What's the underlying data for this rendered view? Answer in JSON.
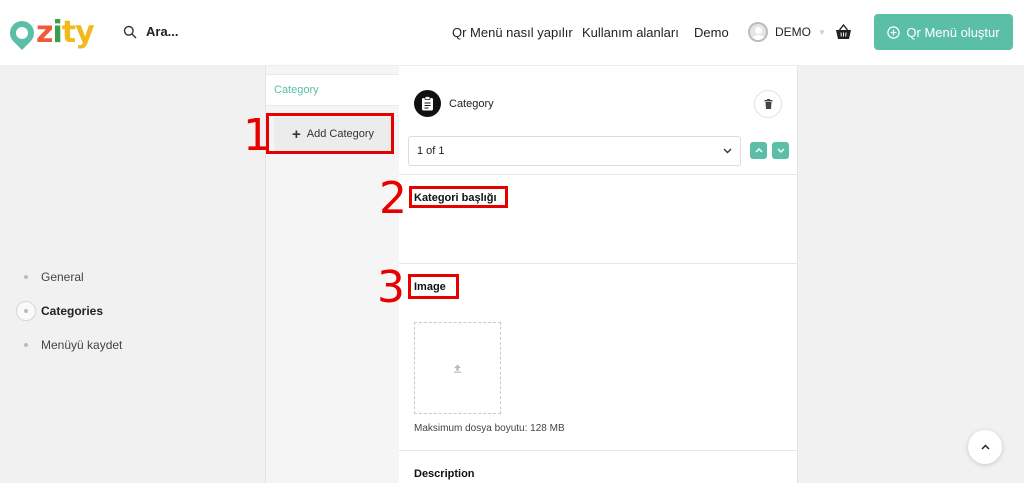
{
  "header": {
    "logo": {
      "letters": [
        "z",
        "i",
        "t",
        "y"
      ],
      "colors": [
        "#ef5a3c",
        "#3a9e4b",
        "#f3b81c",
        "#f3b81c"
      ]
    },
    "search": {
      "label": "Ara...",
      "icon": "search-icon"
    },
    "nav": [
      {
        "label": "Qr Menü nasıl yapılır"
      },
      {
        "label": "Kullanım alanları"
      },
      {
        "label": "Demo"
      }
    ],
    "user": {
      "name": "DEMO",
      "caret": "▼"
    },
    "cta_label": "Qr Menü oluştur",
    "brand_color": "#5bbfa7"
  },
  "steps": [
    {
      "label": "General",
      "active": false
    },
    {
      "label": "Categories",
      "active": true
    },
    {
      "label": "Menüyü kaydet",
      "active": false
    }
  ],
  "category_col": {
    "tab_label": "Category",
    "add_button": {
      "icon": "+",
      "label": "Add Category"
    }
  },
  "panel": {
    "title": "Category",
    "selector_value": "1 of 1",
    "fields": {
      "title_label": "Kategori başlığı",
      "image_label": "Image",
      "max_size": "Maksimum dosya boyutu: 128 MB",
      "description_label": "Description"
    }
  },
  "annotations": [
    "1",
    "2",
    "3"
  ],
  "annotation_color": "#e60000"
}
